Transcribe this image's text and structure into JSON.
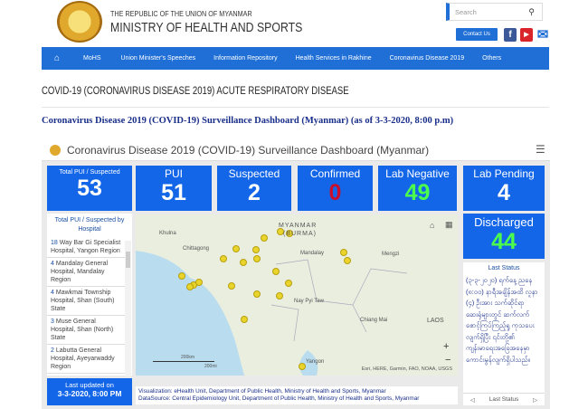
{
  "header": {
    "republic": "THE REPUBLIC OF THE UNION OF MYANMAR",
    "ministry": "MINISTRY OF HEALTH AND SPORTS",
    "search_placeholder": "Search",
    "contact": "Contact Us"
  },
  "nav": [
    "MoHS",
    "Union Minister's Speeches",
    "Information Repository",
    "Health Services in Rakhine",
    "Coronavirus Disease 2019",
    "Others"
  ],
  "page_title": "COVID-19 (CORONAVIRUS DISEASE 2019) ACUTE RESPIRATORY DISEASE",
  "subtitle": "Coronavirus Disease 2019 (COVID-19) Surveillance Dashboard (Myanmar) (as of 3-3-2020, 8:00 p.m)",
  "dashboard": {
    "title": "Coronavirus Disease 2019 (COVID-19) Surveillance Dashboard (Myanmar)",
    "cards": [
      {
        "label": "Total PUI / Suspected",
        "value": "53",
        "color": "#ffffff"
      },
      {
        "label": "PUI",
        "value": "51",
        "color": "#ffffff"
      },
      {
        "label": "Suspected",
        "value": "2",
        "color": "#ffffff"
      },
      {
        "label": "Confirmed",
        "value": "0",
        "color": "#c8102e"
      },
      {
        "label": "Lab Negative",
        "value": "49",
        "color": "#4cff4c"
      },
      {
        "label": "Lab Pending",
        "value": "4",
        "color": "#ffffff"
      }
    ],
    "discharged": {
      "label": "Discharged",
      "value": "44",
      "color": "#4cff4c"
    },
    "list": {
      "title": "Total PUI / Suspected by Hospital",
      "items": [
        {
          "count": "18",
          "name": "Way Bar Gi Specialist Hospital, Yangon Region"
        },
        {
          "count": "4",
          "name": "Mandalay General Hospital, Mandalay Region"
        },
        {
          "count": "4",
          "name": "Mawkmai Township Hospital, Shan (South) State"
        },
        {
          "count": "3",
          "name": "Muse General Hospital, Shan (North) State"
        },
        {
          "count": "2",
          "name": "Labutta General Hospital, Ayeyarwaddy Region"
        }
      ]
    },
    "updated": {
      "label": "Last updated on",
      "value": "3-3-2020, 8:00 PM"
    },
    "map": {
      "labels": [
        "MYANMAR",
        "(BURMA)",
        "Khulna",
        "Chittagong",
        "Mandalay",
        "Nay Pyi Taw",
        "Chiang Mai",
        "LAOS",
        "Yangon",
        "Mengzi"
      ],
      "scale_km": "200km",
      "scale_mi": "200mi",
      "attribution": "Esri, HERE, Garmin, FAO, NOAA, USGS"
    },
    "credits": {
      "visualization": "Visualization: eHealth Unit, Department of Public Health, Ministry of Health and Sports, Myanmar",
      "datasource": "DataSource: Central Epidemiology Unit, Department of Public Health, Ministry of Health and Sports, Myanmar"
    },
    "last_status": {
      "title": "Last Status",
      "text": "(၃-၃-၂၀၂၀) ရက်နေ့ ညနေ (၈:၀၀) နာရီအချိန်အထိ လူနာ (၄) ဦးအား သက်ဆိုင်ရာ ဆေးရုံများတွင် ဆက်လက်စောင့်ကြပ်ကြည့်ရှု ကုသပေးလျက်ရှိပြီး ၎င်းတို့၏ ကျန်းမာရေးအခြေအနေမှာ ကောင်းမွန်လျက်ရှိပါသည်။",
      "nav_label": "Last Status"
    }
  }
}
